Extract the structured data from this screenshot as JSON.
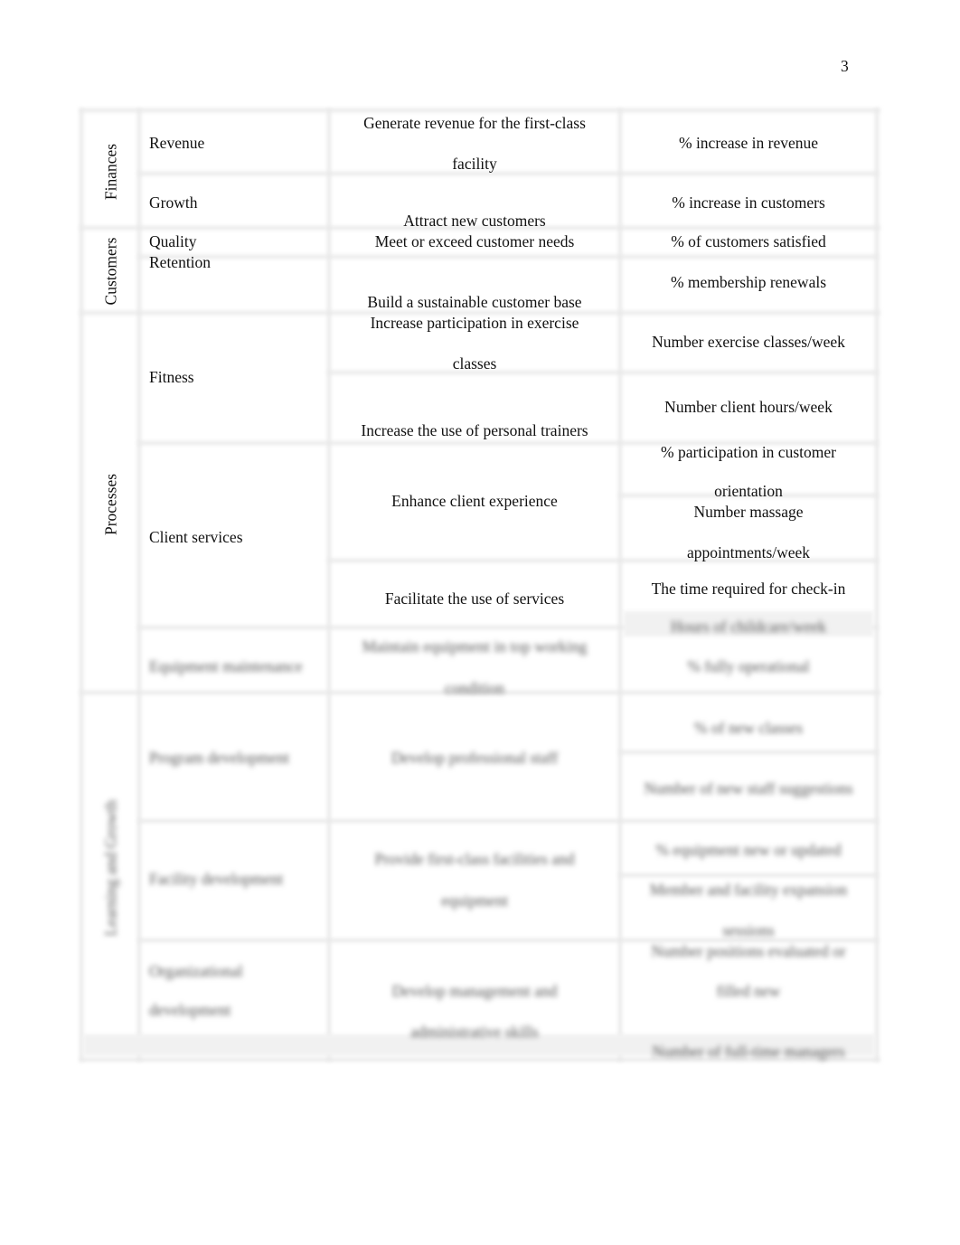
{
  "page_number": "3",
  "perspectives": [
    "Finances",
    "Customers",
    "Processes",
    "Learning and Growth"
  ],
  "rows": [
    {
      "objective": "Revenue",
      "goal_lines": [
        "Generate revenue for the first-class",
        "facility"
      ],
      "measure_lines": [
        "% increase in revenue"
      ]
    },
    {
      "objective": "Growth",
      "goal_lines": [
        "Attract new customers"
      ],
      "measure_lines": [
        "% increase in customers"
      ]
    },
    {
      "objective": "Quality",
      "goal_lines": [
        "Meet or exceed customer needs"
      ],
      "measure_lines": [
        "% of customers satisfied"
      ]
    },
    {
      "objective": "Retention",
      "goal_lines": [
        "Build a sustainable customer base"
      ],
      "measure_lines": [
        "% membership renewals"
      ]
    },
    {
      "objective": "Fitness",
      "goal_lines": [
        "Increase participation in exercise",
        "classes"
      ],
      "measure_lines": [
        "Number exercise classes/week"
      ]
    },
    {
      "objective": "",
      "goal_lines": [
        "Increase the use of personal trainers"
      ],
      "measure_lines": [
        "Number client hours/week"
      ]
    },
    {
      "objective": "Client services",
      "goal_lines": [
        "Enhance client experience"
      ],
      "measure_lines": [
        "% participation in customer",
        "orientation",
        "Number massage",
        "appointments/week"
      ]
    },
    {
      "objective": "",
      "goal_lines": [
        "Facilitate the use of services"
      ],
      "measure_lines": [
        "The time required for check-in",
        "Hours of childcare/week"
      ]
    },
    {
      "objective": "Equipment maintenance",
      "goal_lines": [
        "Maintain equipment in top working",
        "condition"
      ],
      "measure_lines": [
        "% fully operational"
      ]
    },
    {
      "objective": "Program development",
      "goal_lines": [
        "Develop professional staff"
      ],
      "measure_lines": [
        "% of new classes",
        "Number of new staff suggestions"
      ]
    },
    {
      "objective": "Facility development",
      "goal_lines": [
        "Provide first-class facilities and",
        "equipment"
      ],
      "measure_lines": [
        "% equipment new or updated",
        "Member and facility expansion",
        "sessions"
      ]
    },
    {
      "objective": "Organizational",
      "objective2": "development",
      "goal_lines": [
        "Develop management and",
        "administrative skills"
      ],
      "measure_lines": [
        "Number positions evaluated or",
        "filled new",
        "Number of full-time managers"
      ]
    }
  ]
}
